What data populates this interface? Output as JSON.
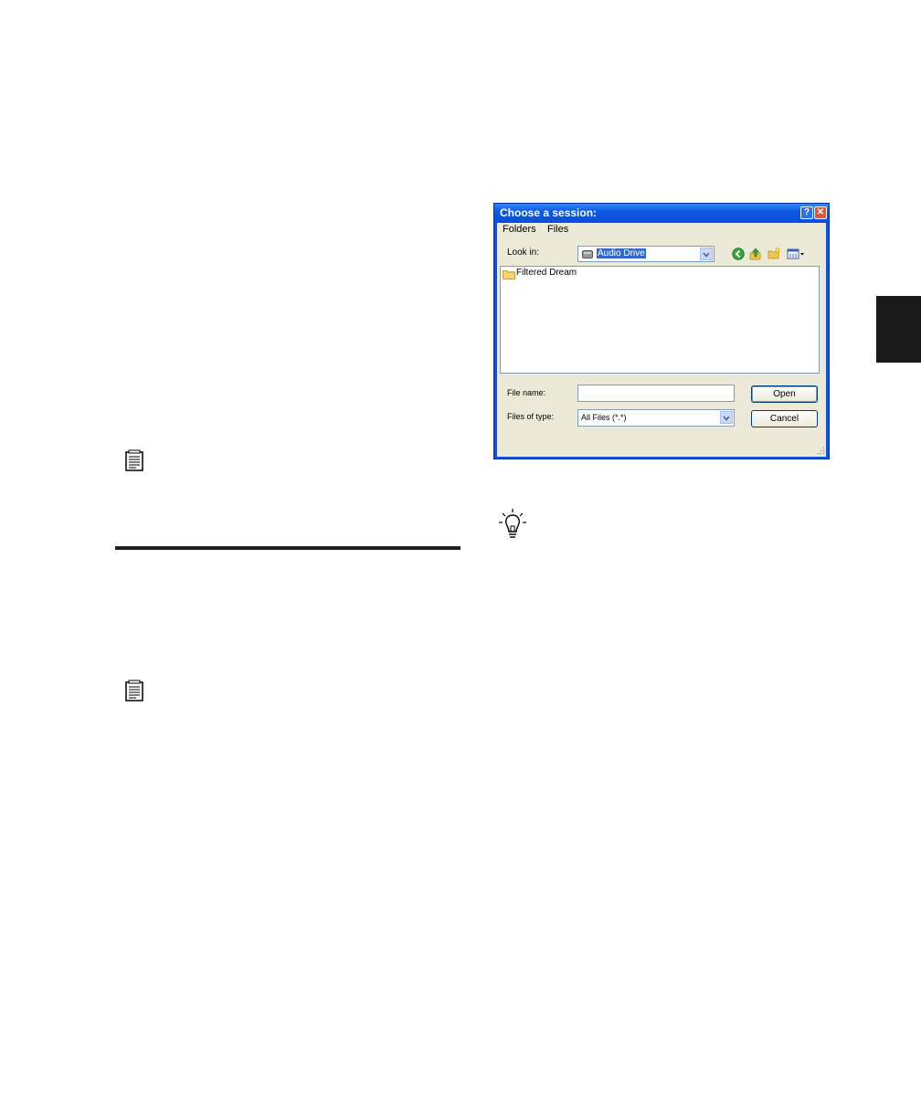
{
  "dialog": {
    "title": "Choose a session:",
    "menu": [
      "Folders",
      "Files"
    ],
    "look_in_label": "Look in:",
    "look_in_value": "Audio Drive",
    "toolbar_icons": [
      "back-icon",
      "up-folder-icon",
      "new-folder-icon",
      "views-menu-icon"
    ],
    "files": [
      {
        "name": "Filtered Dream",
        "icon": "folder-icon"
      }
    ],
    "file_name_label": "File name:",
    "file_name_value": "",
    "files_of_type_label": "Files of type:",
    "files_of_type_value": "All Files (*.*)",
    "open_label": "Open",
    "cancel_label": "Cancel",
    "help_glyph": "?",
    "close_glyph": "✕"
  },
  "colors": {
    "titlebar": "#0b4ed8",
    "dialog_face": "#ece9d8",
    "selection": "#316ac5",
    "side_tab": "#1a1a1a"
  }
}
